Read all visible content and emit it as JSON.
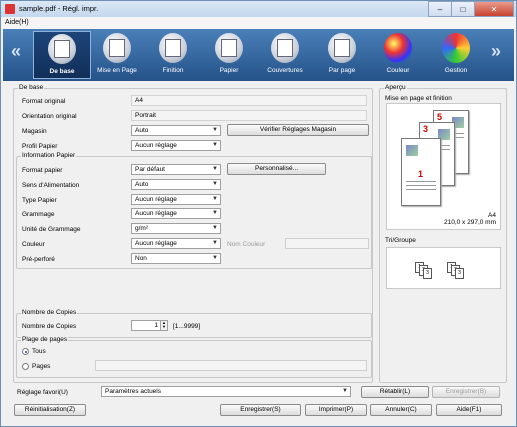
{
  "window": {
    "title": "sample.pdf - Régl. impr.",
    "buttons": {
      "minimize": "‒",
      "maximize": "□",
      "close": "✕"
    }
  },
  "menu": {
    "help": "Aide(H)"
  },
  "toolbar": {
    "prev": "«",
    "next": "»",
    "tabs": [
      {
        "label": "De base",
        "icon": "basic-settings-icon"
      },
      {
        "label": "Mise en Page",
        "icon": "layout-icon"
      },
      {
        "label": "Finition",
        "icon": "finishing-icon"
      },
      {
        "label": "Papier",
        "icon": "paper-icon"
      },
      {
        "label": "Couvertures",
        "icon": "covers-icon"
      },
      {
        "label": "Par page",
        "icon": "per-page-icon"
      },
      {
        "label": "Couleur",
        "icon": "color-icon"
      },
      {
        "label": "Gestion",
        "icon": "management-icon"
      }
    ]
  },
  "basic": {
    "group_label": "De base",
    "original_format_label": "Format original",
    "original_format": "A4",
    "original_orientation_label": "Orientation original",
    "original_orientation": "Portrait",
    "tray_label": "Magasin",
    "tray": "Auto",
    "check_tray_button": "Vérifier Réglages Magasin",
    "paper_profile_label": "Profil Papier",
    "paper_profile": "Aucun réglage"
  },
  "paper_info": {
    "group_label": "Information Papier",
    "paper_size_label": "Format papier",
    "paper_size": "Par défaut",
    "custom_button": "Personnalisé...",
    "feed_direction_label": "Sens d'Alimentation",
    "feed_direction": "Auto",
    "paper_type_label": "Type Papier",
    "paper_type": "Aucun réglage",
    "weight_label": "Grammage",
    "weight": "Aucun réglage",
    "weight_unit_label": "Unité de Grammage",
    "weight_unit": "g/m²",
    "color_label": "Couleur",
    "color": "Aucun réglage",
    "color_name_label": "Nom Couleur",
    "prepunched_label": "Pré-perforé",
    "prepunched": "Non"
  },
  "copies": {
    "group_label": "Nombre de Copies",
    "label": "Nombre de Copies",
    "value": "1",
    "range": "[1...9999]"
  },
  "page_range": {
    "group_label": "Plage de pages",
    "all_label": "Tous",
    "pages_label": "Pages"
  },
  "preview": {
    "group_label": "Aperçu",
    "subtitle": "Mise en page et finition",
    "paper": "A4",
    "dimensions": "210,0 x 297,0 mm",
    "pages": [
      "5",
      "3",
      "1"
    ]
  },
  "sort": {
    "label": "Tri/Groupe",
    "set1": [
      "1",
      "2",
      "3"
    ],
    "set2": [
      "1",
      "2",
      "3"
    ]
  },
  "footer": {
    "favorite_label": "Réglage favori(U)",
    "favorite_value": "Paramètres actuels",
    "restore_button": "Rétablir(L)",
    "save_button": "Enregistrer(B)",
    "reset_button": "Réinitialisation(Z)",
    "register_button": "Enregistrer(S)",
    "print_button": "Imprimer(P)",
    "cancel_button": "Annuler(C)",
    "help_button": "Aide(F1)"
  }
}
